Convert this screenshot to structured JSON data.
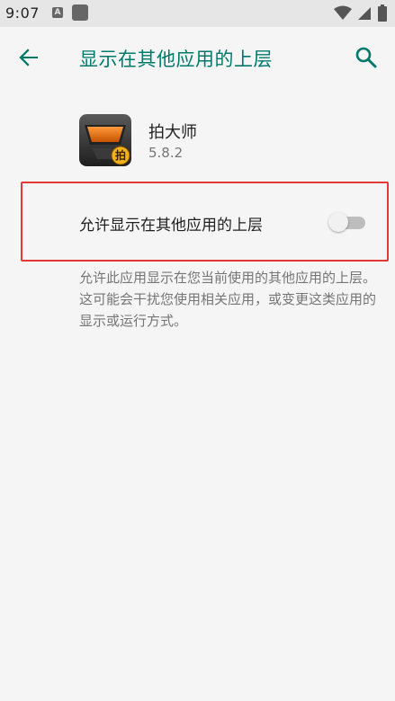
{
  "status_bar": {
    "time": "9:07",
    "notification_icons": [
      "font-a-icon",
      "square-app-icon"
    ],
    "system_icons": [
      "wifi-icon",
      "signal-icon",
      "battery-icon"
    ]
  },
  "app_bar": {
    "title": "显示在其他应用的上层",
    "back_icon": "arrow-left-icon",
    "search_icon": "search-icon",
    "accent_color": "#00796b"
  },
  "app": {
    "name": "拍大师",
    "version": "5.8.2",
    "icon_badge": "拍"
  },
  "setting": {
    "label": "允许显示在其他应用的上层",
    "enabled": false,
    "highlight_color": "#e53935"
  },
  "description": "允许此应用显示在您当前使用的其他应用的上层。这可能会干扰您使用相关应用，或变更这类应用的显示或运行方式。"
}
